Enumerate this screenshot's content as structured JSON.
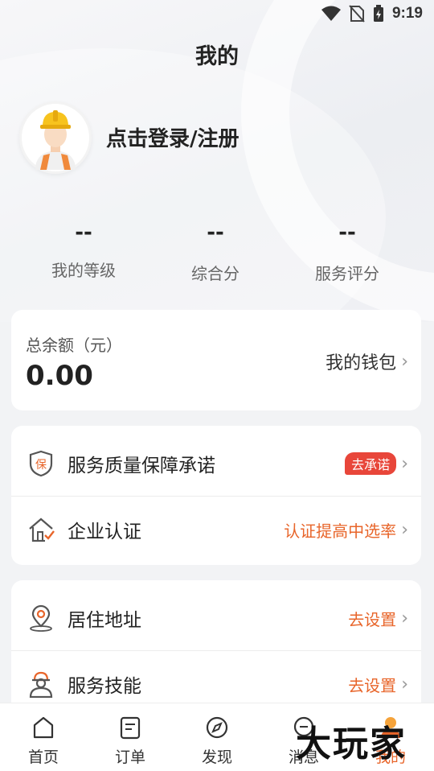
{
  "status_bar": {
    "time": "9:19"
  },
  "header": {
    "title": "我的"
  },
  "profile": {
    "login_text": "点击登录/注册"
  },
  "stats": [
    {
      "value": "--",
      "label": "我的等级"
    },
    {
      "value": "--",
      "label": "综合分"
    },
    {
      "value": "--",
      "label": "服务评分"
    }
  ],
  "wallet": {
    "label": "总余额（元）",
    "amount": "0.00",
    "link": "我的钱包"
  },
  "section1": [
    {
      "title": "服务质量保障承诺",
      "right": "去承诺",
      "icon": "shield-bao-icon"
    },
    {
      "title": "企业认证",
      "right": "认证提高中选率",
      "icon": "house-check-icon"
    }
  ],
  "section2": [
    {
      "title": "居住地址",
      "right": "去设置",
      "icon": "location-pin-icon"
    },
    {
      "title": "服务技能",
      "right": "去设置",
      "icon": "worker-icon"
    }
  ],
  "tabs": [
    {
      "label": "首页",
      "icon": "home-icon"
    },
    {
      "label": "订单",
      "icon": "order-icon"
    },
    {
      "label": "发现",
      "icon": "compass-icon"
    },
    {
      "label": "消息",
      "icon": "message-icon"
    },
    {
      "label": "我的",
      "icon": "profile-icon"
    }
  ],
  "watermark": "大玩家",
  "colors": {
    "accent": "#e8652a",
    "badge": "#e8463a",
    "background": "#f2f3f5"
  }
}
